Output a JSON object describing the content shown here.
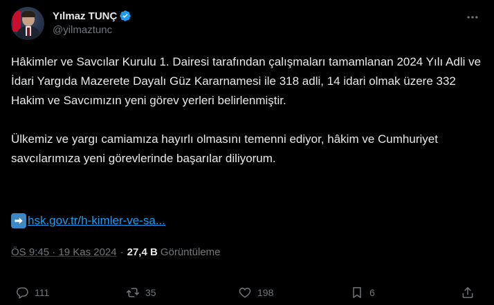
{
  "author": {
    "display_name": "Yılmaz TUNÇ",
    "handle": "@yilmaztunc",
    "verified_icon": "verified-badge-icon"
  },
  "more_icon": "more-dots-icon",
  "tweet": {
    "paragraph_1": "Hâkimler ve Savcılar Kurulu 1. Dairesi tarafından çalışmaları tamamlanan 2024 Yılı Adli ve İdari Yargıda Mazerete Dayalı Güz Kararnamesi ile 318 adli, 14 idari olmak üzere 332 Hakim ve Savcımızın yeni görev yerleri belirlenmiştir.",
    "paragraph_2": "Ülkemiz ve yargı camiamıza hayırlı olmasını temenni ediyor, hâkim ve Cumhuriyet savcılarımıza yeni görevlerinde başarılar diliyorum.",
    "link_icon": "right-arrow-emoji-icon",
    "link_text": "hsk.gov.tr/h-kimler-ve-sa..."
  },
  "meta": {
    "time": "ÖS 9:45 · 19 Kas 2024",
    "separator": "·",
    "views_count": "27,4 B",
    "views_label": "Görüntüleme"
  },
  "actions": {
    "reply_count": "111",
    "retweet_count": "35",
    "like_count": "198",
    "bookmark_count": "6"
  },
  "colors": {
    "background": "#000000",
    "text": "#e7e9ea",
    "muted": "#71767b",
    "link": "#1d9bf0",
    "verified": "#1d9bf0"
  }
}
